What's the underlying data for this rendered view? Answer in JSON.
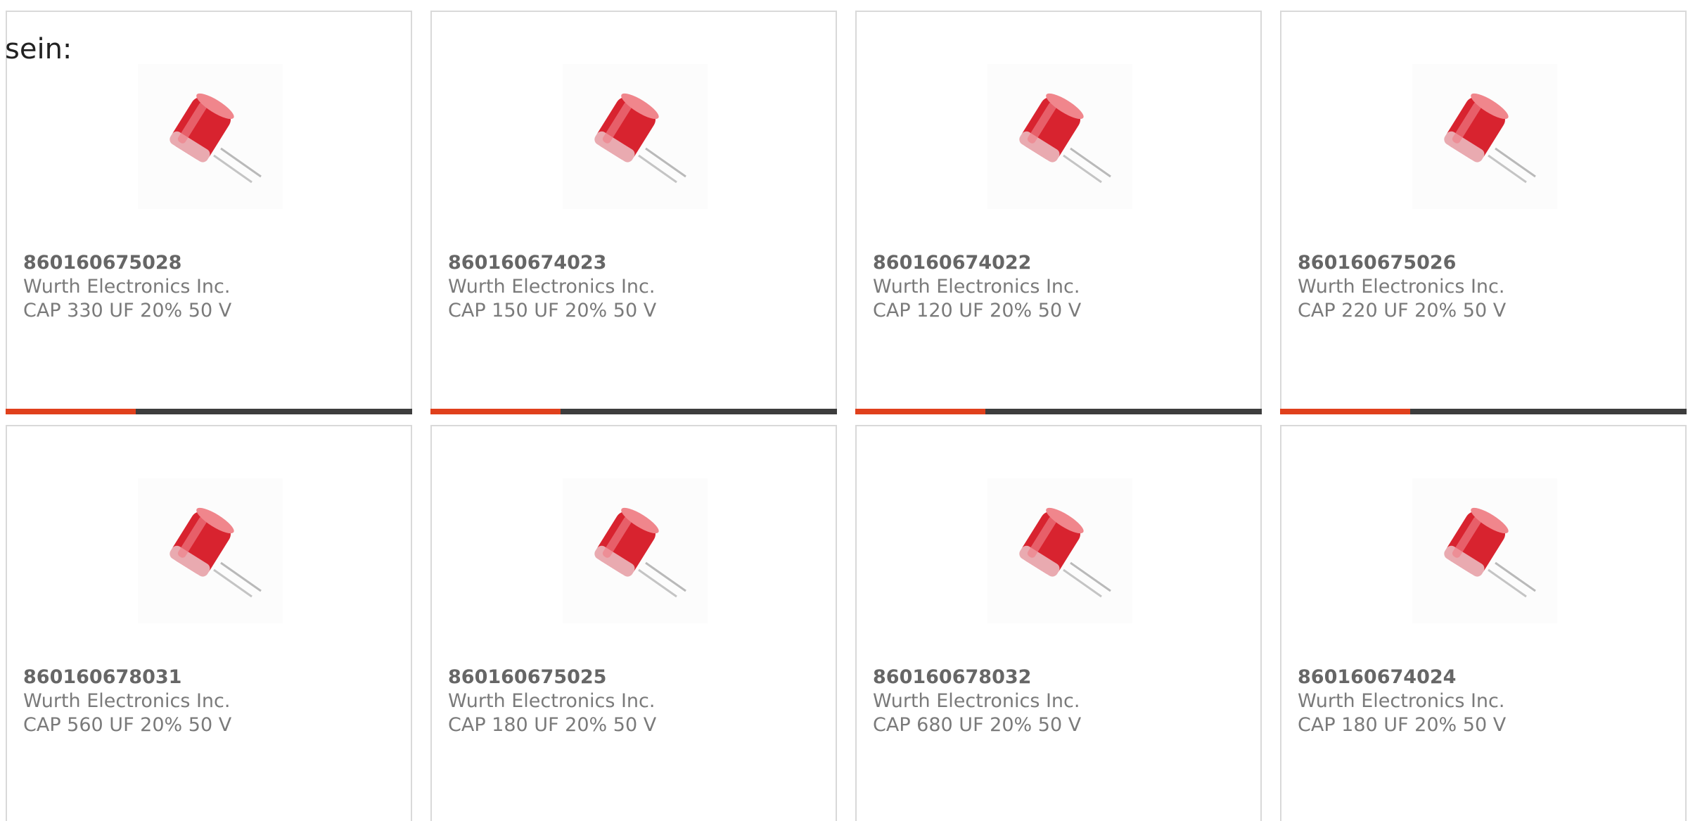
{
  "intro": {
    "text": "sein:"
  },
  "products": [
    {
      "part_number": "860160675028",
      "manufacturer": "Wurth Electronics Inc.",
      "description": "CAP 330 UF 20% 50 V",
      "image": "capacitor-image",
      "progress": 0.32
    },
    {
      "part_number": "860160674023",
      "manufacturer": "Wurth Electronics Inc.",
      "description": "CAP 150 UF 20% 50 V",
      "image": "capacitor-image",
      "progress": 0.32
    },
    {
      "part_number": "860160674022",
      "manufacturer": "Wurth Electronics Inc.",
      "description": "CAP 120 UF 20% 50 V",
      "image": "capacitor-image",
      "progress": 0.32
    },
    {
      "part_number": "860160675026",
      "manufacturer": "Wurth Electronics Inc.",
      "description": "CAP 220 UF 20% 50 V",
      "image": "capacitor-image",
      "progress": 0.32
    },
    {
      "part_number": "860160678031",
      "manufacturer": "Wurth Electronics Inc.",
      "description": "CAP 560 UF 20% 50 V",
      "image": "capacitor-image",
      "progress": null
    },
    {
      "part_number": "860160675025",
      "manufacturer": "Wurth Electronics Inc.",
      "description": "CAP 180 UF 20% 50 V",
      "image": "capacitor-image",
      "progress": null
    },
    {
      "part_number": "860160678032",
      "manufacturer": "Wurth Electronics Inc.",
      "description": "CAP 680 UF 20% 50 V",
      "image": "capacitor-image",
      "progress": null
    },
    {
      "part_number": "860160674024",
      "manufacturer": "Wurth Electronics Inc.",
      "description": "CAP 180 UF 20% 50 V",
      "image": "capacitor-image",
      "progress": null
    }
  ],
  "colors": {
    "accent": "#e0401c",
    "bar_track": "#3d3d3d",
    "card_border": "#d9d9d9",
    "capacitor_red": "#d8232f"
  }
}
